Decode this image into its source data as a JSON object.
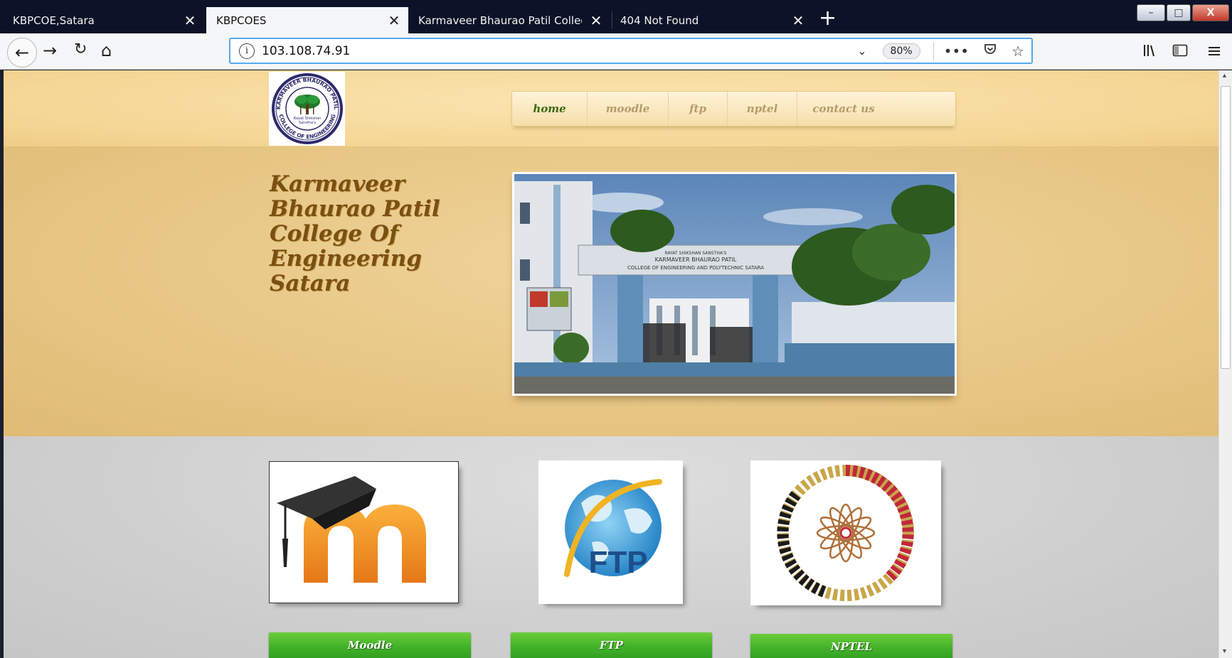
{
  "browser": {
    "tabs": [
      {
        "label": "KBPCOE,Satara",
        "active": false
      },
      {
        "label": "KBPCOES",
        "active": true
      },
      {
        "label": "Karmaveer Bhaurao Patil College of",
        "active": false
      },
      {
        "label": "404 Not Found",
        "active": false
      }
    ],
    "new_tab_icon": "+",
    "url": "103.108.74.91",
    "zoom": "80%",
    "window_controls": {
      "minimize": "–",
      "maximize": "□",
      "close": "X"
    }
  },
  "site": {
    "logo": {
      "ring_top": "KARMAVEER BHAURAO PATIL",
      "ring_bottom": "COLLEGE OF ENGINEERING",
      "center_line1": "Rayat Shikshan",
      "center_line2": "Sanstha's"
    },
    "nav": [
      {
        "label": "home",
        "active": true
      },
      {
        "label": "moodle",
        "active": false
      },
      {
        "label": "ftp",
        "active": false
      },
      {
        "label": "nptel",
        "active": false
      },
      {
        "label": "contact us",
        "active": false
      }
    ],
    "hero_title_lines": [
      "Karmaveer",
      "Bhaurao Patil",
      "College Of",
      "Engineering",
      "Satara"
    ],
    "photo_sign": {
      "line1": "RAYAT SHIKSHAN SANSTHA'S",
      "line2": "KARMAVEER BHAURAO PATIL",
      "line3": "COLLEGE OF ENGINEERING AND POLYTECHNIC SATARA"
    },
    "ftp_logo_text": "FTP",
    "buttons": {
      "moodle": "Moodle",
      "ftp": "FTP",
      "nptel": "NPTEL"
    }
  },
  "colors": {
    "accent_green": "#42b22a",
    "title_brown": "#7a4f12",
    "nav_active": "#3b6a14",
    "header_bg": "#f5d796",
    "hero_bg": "#e7c684"
  }
}
